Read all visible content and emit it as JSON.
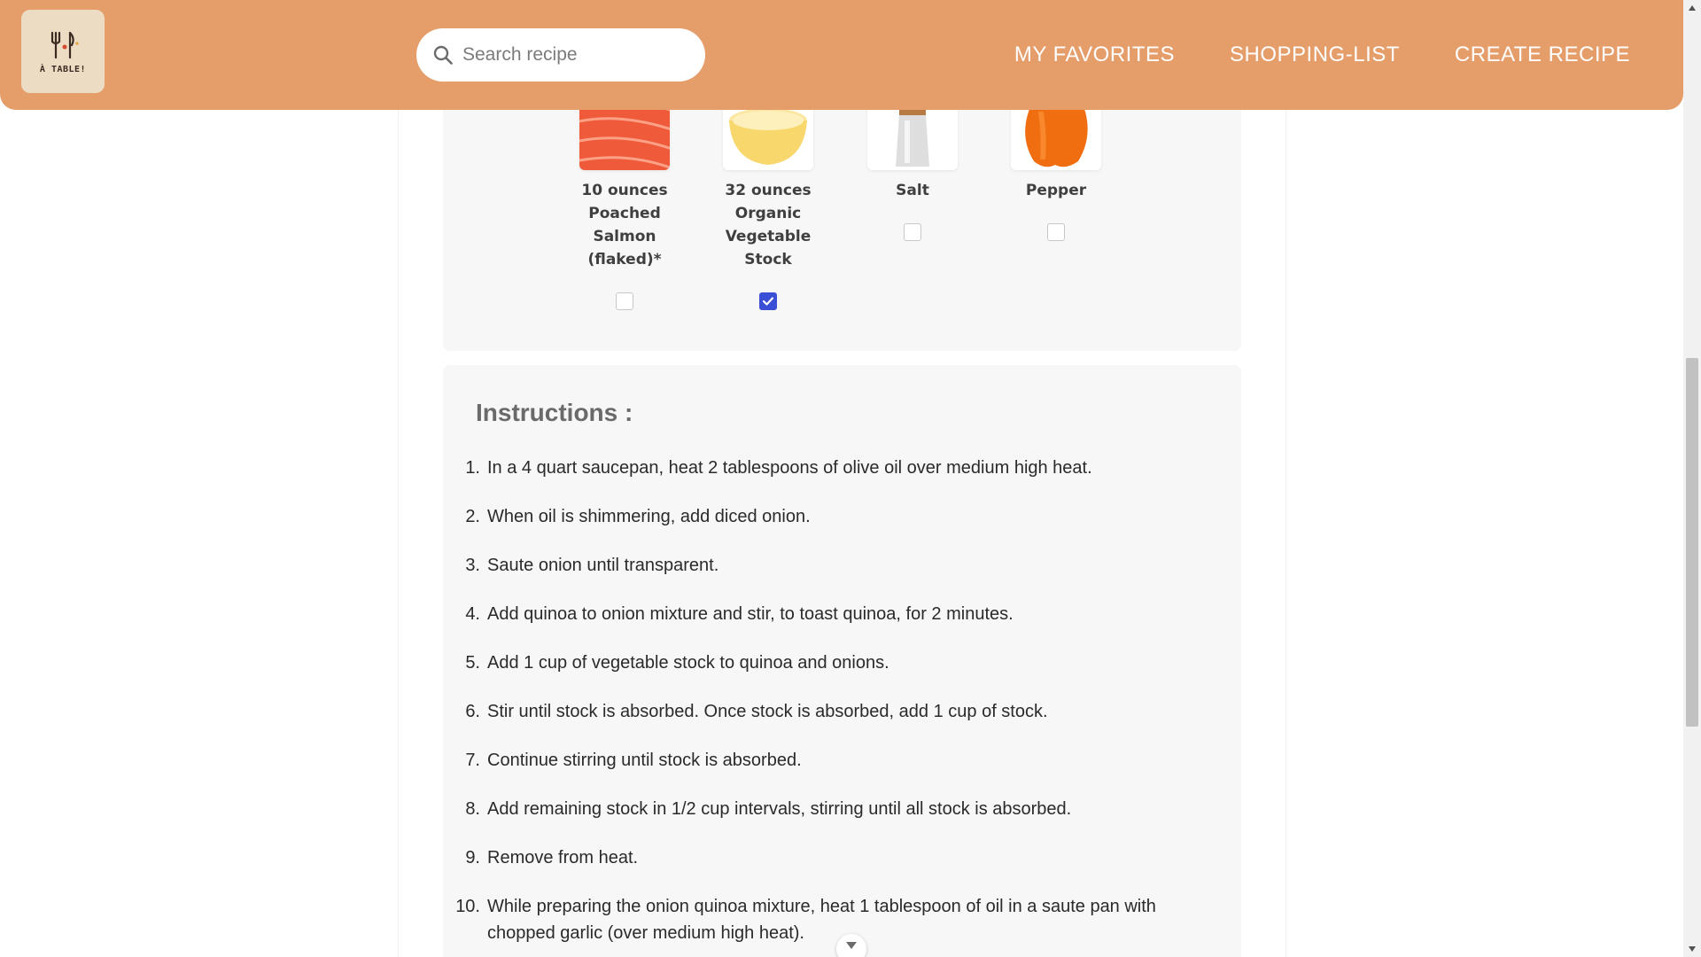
{
  "header": {
    "logo_text": "À TABLE!",
    "search_placeholder": "Search recipe",
    "nav": [
      {
        "label": "MY FAVORITES"
      },
      {
        "label": "SHOPPING-LIST"
      },
      {
        "label": "CREATE RECIPE"
      }
    ]
  },
  "ingredients": [
    {
      "label": "10 ounces Poached Salmon (flaked)*",
      "checked": false,
      "icon": "salmon-image"
    },
    {
      "label": "32 ounces Organic Vegetable Stock",
      "checked": true,
      "icon": "stock-bowl-image"
    },
    {
      "label": "Salt",
      "checked": false,
      "icon": "salt-shaker-image"
    },
    {
      "label": "Pepper",
      "checked": false,
      "icon": "bell-pepper-image"
    }
  ],
  "instructions": {
    "title": "Instructions :",
    "steps": [
      {
        "num": "1.",
        "text": "In a 4 quart saucepan, heat 2 tablespoons of olive oil over medium high heat."
      },
      {
        "num": "2.",
        "text": "When oil is shimmering, add diced onion."
      },
      {
        "num": "3.",
        "text": "Saute onion until transparent."
      },
      {
        "num": "4.",
        "text": "Add quinoa to onion mixture and stir, to toast quinoa, for 2 minutes."
      },
      {
        "num": "5.",
        "text": "Add 1 cup of vegetable stock to quinoa and onions."
      },
      {
        "num": "6.",
        "text": "Stir until stock is absorbed. Once stock is absorbed, add 1 cup of stock."
      },
      {
        "num": "7.",
        "text": "Continue stirring until stock is absorbed."
      },
      {
        "num": "8.",
        "text": "Add remaining stock in 1/2 cup intervals, stirring until all stock is absorbed."
      },
      {
        "num": "9.",
        "text": "Remove from heat."
      },
      {
        "num": "10.",
        "text": "While preparing the onion quinoa mixture, heat 1 tablespoon of oil in a saute pan with chopped garlic (over medium high heat)."
      }
    ]
  },
  "colors": {
    "header": "#e59d6a",
    "checkbox_checked": "#3a4fd6",
    "panel": "#f7f7f7"
  }
}
